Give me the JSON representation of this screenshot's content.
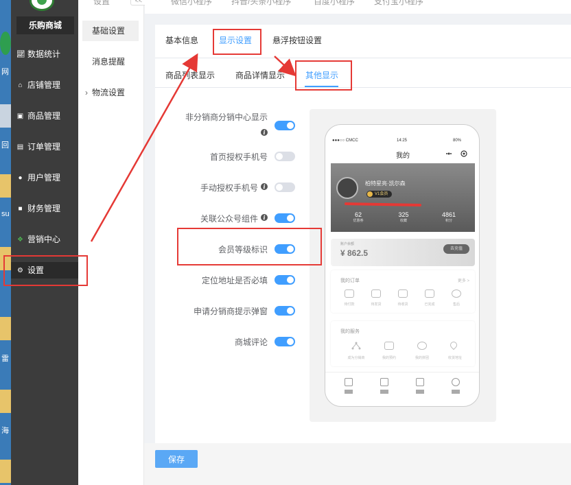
{
  "desktop": {
    "labels": [
      "网",
      "回",
      "su",
      "雷",
      "海"
    ]
  },
  "sidebar": {
    "brand": "乐购商城",
    "items": [
      {
        "label": "数据统计",
        "icon": "chart-icon"
      },
      {
        "label": "店铺管理",
        "icon": "shop-icon"
      },
      {
        "label": "商品管理",
        "icon": "goods-icon"
      },
      {
        "label": "订单管理",
        "icon": "order-icon"
      },
      {
        "label": "用户管理",
        "icon": "user-icon"
      },
      {
        "label": "财务管理",
        "icon": "finance-icon"
      },
      {
        "label": "营销中心",
        "icon": "marketing-icon"
      },
      {
        "label": "设置",
        "icon": "gear-icon"
      }
    ]
  },
  "subnav": {
    "top": "设置",
    "items": [
      {
        "label": "基础设置"
      },
      {
        "label": "消息提醒"
      },
      {
        "label": "物流设置"
      }
    ],
    "collapse": "<<"
  },
  "topbar": {
    "items": [
      "微信小程序",
      "抖音/头条小程序",
      "百度小程序",
      "支付宝小程序"
    ]
  },
  "tabs1": [
    "基本信息",
    "显示设置",
    "悬浮按钮设置"
  ],
  "tabs2": [
    "商品列表显示",
    "商品详情显示",
    "其他显示"
  ],
  "settings": [
    {
      "label": "非分销商分销中心显示",
      "on": true,
      "info": true
    },
    {
      "label": "首页授权手机号",
      "on": false,
      "info": false
    },
    {
      "label": "手动授权手机号",
      "on": false,
      "info": true
    },
    {
      "label": "关联公众号组件",
      "on": true,
      "info": true
    },
    {
      "label": "会员等级标识",
      "on": true,
      "info": false
    },
    {
      "label": "定位地址是否必填",
      "on": true,
      "info": false
    },
    {
      "label": "申请分销商提示弹窗",
      "on": true,
      "info": false
    },
    {
      "label": "商城评论",
      "on": true,
      "info": false
    }
  ],
  "preview": {
    "carrier": "●●●○○ CMCC",
    "time": "14:25",
    "battery": "80%",
    "title": "我的",
    "username": "柏特星亮·凯尔森",
    "vip": "V1会员",
    "stats": [
      {
        "n": "62",
        "l": "优惠券"
      },
      {
        "n": "325",
        "l": "收藏"
      },
      {
        "n": "4861",
        "l": "积分"
      }
    ],
    "balance_label": "账户余额",
    "balance": "¥ 862.5",
    "recharge": "去充值",
    "orders_title": "我的订单",
    "orders_more": "更多 >",
    "orders": [
      "待付款",
      "待发货",
      "待收货",
      "已完成",
      "售后"
    ],
    "services_title": "我的服务",
    "services": [
      "成为分销商",
      "我的预约",
      "我的拼团",
      "收货地址"
    ]
  },
  "save_label": "保存"
}
